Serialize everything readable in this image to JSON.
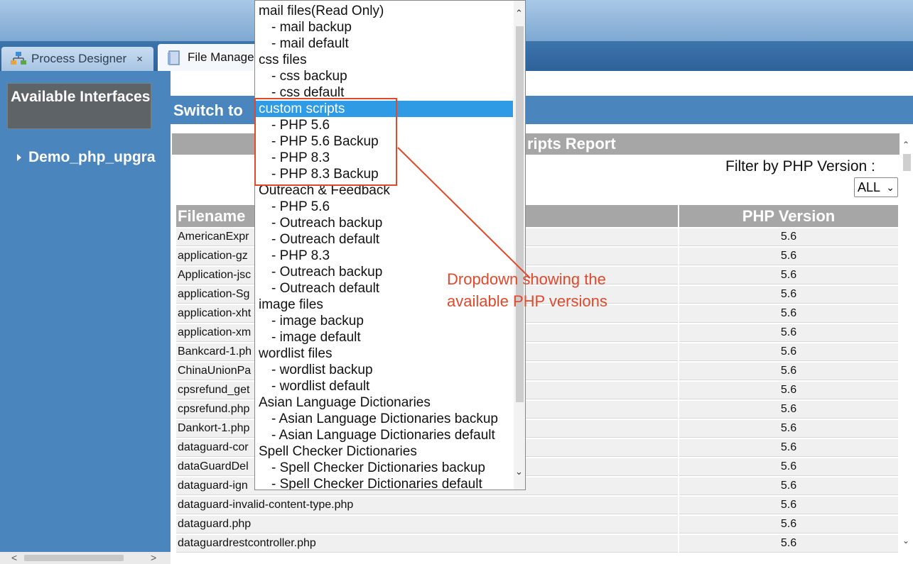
{
  "tabs": [
    {
      "label": "Process Designer",
      "icon": "process-designer-icon",
      "close": "×"
    },
    {
      "label": "File Manage",
      "icon": "document-icon"
    }
  ],
  "sidebar": {
    "title": "Available Interfaces",
    "tree_item": "Demo_php_upgra"
  },
  "switch_label": "Switch to",
  "report": {
    "title": "ripts Report",
    "filter_label": "Filter by PHP Version :",
    "filter_value": "ALL",
    "columns": [
      "Filename",
      "PHP Version"
    ],
    "rows": [
      {
        "filename": "AmericanExpr",
        "version": "5.6"
      },
      {
        "filename": "application-gz",
        "version": "5.6"
      },
      {
        "filename": "Application-jsc",
        "version": "5.6"
      },
      {
        "filename": "application-Sg",
        "version": "5.6"
      },
      {
        "filename": "application-xht",
        "version": "5.6"
      },
      {
        "filename": "application-xm",
        "version": "5.6"
      },
      {
        "filename": "Bankcard-1.ph",
        "version": "5.6"
      },
      {
        "filename": "ChinaUnionPa",
        "version": "5.6"
      },
      {
        "filename": "cpsrefund_get",
        "version": "5.6"
      },
      {
        "filename": "cpsrefund.php",
        "version": "5.6"
      },
      {
        "filename": "Dankort-1.php",
        "version": "5.6"
      },
      {
        "filename": "dataguard-cor",
        "version": "5.6"
      },
      {
        "filename": "dataGuardDel",
        "version": "5.6"
      },
      {
        "filename": "dataguard-ign",
        "version": "5.6"
      },
      {
        "filename": "dataguard-invalid-content-type.php",
        "version": "5.6"
      },
      {
        "filename": "dataguard.php",
        "version": "5.6"
      },
      {
        "filename": "dataguardrestcontroller.php",
        "version": "5.6"
      }
    ]
  },
  "dropdown": {
    "items": [
      {
        "label": "mail files(Read Only)",
        "sub": false
      },
      {
        "label": "- mail backup",
        "sub": true
      },
      {
        "label": "- mail default",
        "sub": true
      },
      {
        "label": "css files",
        "sub": false
      },
      {
        "label": "- css backup",
        "sub": true
      },
      {
        "label": "- css default",
        "sub": true
      },
      {
        "label": "custom scripts",
        "sub": false,
        "selected": true
      },
      {
        "label": "- PHP 5.6",
        "sub": true
      },
      {
        "label": "- PHP 5.6 Backup",
        "sub": true
      },
      {
        "label": "- PHP 8.3",
        "sub": true
      },
      {
        "label": "- PHP 8.3 Backup",
        "sub": true
      },
      {
        "label": "Outreach & Feedback",
        "sub": false
      },
      {
        "label": "- PHP 5.6",
        "sub": true
      },
      {
        "label": "- Outreach backup",
        "sub": true
      },
      {
        "label": "- Outreach default",
        "sub": true
      },
      {
        "label": "- PHP 8.3",
        "sub": true
      },
      {
        "label": "- Outreach backup",
        "sub": true
      },
      {
        "label": "- Outreach default",
        "sub": true
      },
      {
        "label": "image files",
        "sub": false
      },
      {
        "label": "- image backup",
        "sub": true
      },
      {
        "label": "- image default",
        "sub": true
      },
      {
        "label": "wordlist files",
        "sub": false
      },
      {
        "label": "- wordlist backup",
        "sub": true
      },
      {
        "label": "- wordlist default",
        "sub": true
      },
      {
        "label": "Asian Language Dictionaries",
        "sub": false
      },
      {
        "label": "- Asian Language Dictionaries backup",
        "sub": true
      },
      {
        "label": "- Asian Language Dictionaries default",
        "sub": true
      },
      {
        "label": "Spell Checker Dictionaries",
        "sub": false
      },
      {
        "label": "- Spell Checker Dictionaries backup",
        "sub": true
      },
      {
        "label": "- Spell Checker Dictionaries default",
        "sub": true
      }
    ]
  },
  "annotation": {
    "text_line1": "Dropdown showing the",
    "text_line2": "available PHP versions",
    "color": "#e0492c"
  },
  "colors": {
    "sidebar": "#4a85bd",
    "header_gray": "#a6a6a6",
    "selected": "#2f9be4"
  }
}
